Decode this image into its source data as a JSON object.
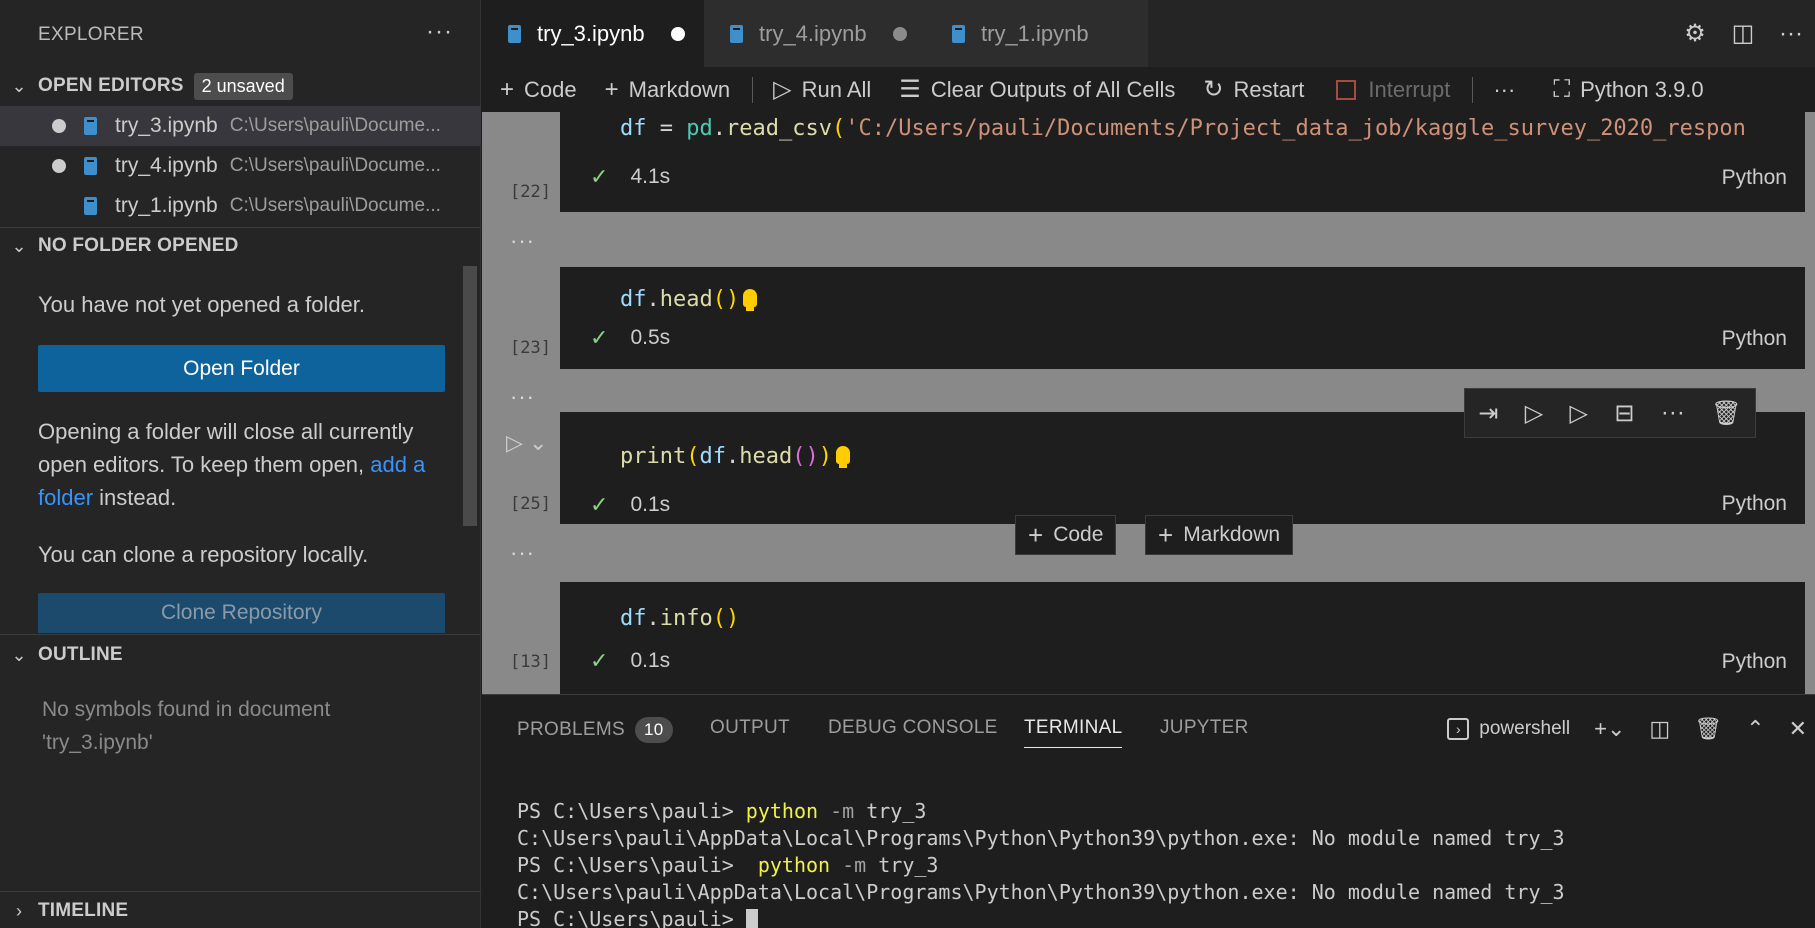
{
  "sidebar": {
    "title": "EXPLORER",
    "more_icon": "ellipsis-icon",
    "open_editors": {
      "label": "OPEN EDITORS",
      "badge": "2 unsaved",
      "items": [
        {
          "name": "try_3.ipynb",
          "path": "C:\\Users\\pauli\\Docume...",
          "dirty": true
        },
        {
          "name": "try_4.ipynb",
          "path": "C:\\Users\\pauli\\Docume...",
          "dirty": true
        },
        {
          "name": "try_1.ipynb",
          "path": "C:\\Users\\pauli\\Docume...",
          "dirty": false
        }
      ]
    },
    "no_folder": {
      "label": "NO FOLDER OPENED",
      "message": "You have not yet opened a folder.",
      "open_button": "Open Folder",
      "info_pre": "Opening a folder will close all currently open editors. To keep them open,",
      "info_link": "add a folder",
      "info_post": " instead.",
      "clone_message": "You can clone a repository locally.",
      "clone_button": "Clone Repository"
    },
    "outline": {
      "label": "OUTLINE",
      "message": "No symbols found in document 'try_3.ipynb'"
    },
    "timeline": {
      "label": "TIMELINE"
    }
  },
  "tabs": [
    {
      "label": "try_3.ipynb",
      "active": true,
      "dirty": true
    },
    {
      "label": "try_4.ipynb",
      "active": false,
      "dirty": true
    },
    {
      "label": "try_1.ipynb",
      "active": false,
      "dirty": false
    }
  ],
  "toolbar": {
    "code": "Code",
    "markdown": "Markdown",
    "run_all": "Run All",
    "clear_outputs": "Clear Outputs of All Cells",
    "restart": "Restart",
    "interrupt": "Interrupt",
    "more": "···",
    "kernel": "Python 3.9.0"
  },
  "cells": [
    {
      "exec_count": "[22]",
      "code_tokens": [
        {
          "t": "df",
          "c": "var"
        },
        {
          "t": " = ",
          "c": "op"
        },
        {
          "t": "pd",
          "c": "mod"
        },
        {
          "t": ".",
          "c": "op"
        },
        {
          "t": "read_csv",
          "c": "fn"
        },
        {
          "t": "(",
          "c": "p1"
        },
        {
          "t": "'C:/Users/pauli/Documents/Project_data_job/kaggle_survey_2020_respon",
          "c": "str"
        }
      ],
      "duration": "4.1s",
      "language": "Python"
    },
    {
      "exec_count": "[23]",
      "code_tokens": [
        {
          "t": "df",
          "c": "var"
        },
        {
          "t": ".",
          "c": "op"
        },
        {
          "t": "head",
          "c": "fn"
        },
        {
          "t": "()",
          "c": "p1"
        }
      ],
      "duration": "0.5s",
      "language": "Python"
    },
    {
      "exec_count": "[25]",
      "code_tokens": [
        {
          "t": "print",
          "c": "fn"
        },
        {
          "t": "(",
          "c": "p1"
        },
        {
          "t": "df",
          "c": "var"
        },
        {
          "t": ".",
          "c": "op"
        },
        {
          "t": "head",
          "c": "fn"
        },
        {
          "t": "()",
          "c": "p2"
        },
        {
          "t": ")",
          "c": "p1"
        }
      ],
      "duration": "0.1s",
      "language": "Python"
    },
    {
      "exec_count": "[13]",
      "code_tokens": [
        {
          "t": "df",
          "c": "var"
        },
        {
          "t": ".",
          "c": "op"
        },
        {
          "t": "info",
          "c": "fn"
        },
        {
          "t": "()",
          "c": "p1"
        }
      ],
      "duration": "0.1s",
      "language": "Python"
    }
  ],
  "insert": {
    "code": "Code",
    "markdown": "Markdown"
  },
  "panel": {
    "tabs": {
      "problems": "PROBLEMS",
      "problems_count": "10",
      "output": "OUTPUT",
      "debug_console": "DEBUG CONSOLE",
      "terminal": "TERMINAL",
      "jupyter": "JUPYTER"
    },
    "shell": "powershell",
    "terminal_lines": [
      {
        "prompt": "PS C:\\Users\\pauli> ",
        "cmd": "python",
        "flag": " -m",
        "arg": " try_3"
      },
      {
        "text": "C:\\Users\\pauli\\AppData\\Local\\Programs\\Python\\Python39\\python.exe: No module named try_3"
      },
      {
        "prompt": "PS C:\\Users\\pauli>  ",
        "cmd": "python",
        "flag": " -m",
        "arg": " try_3"
      },
      {
        "text": "C:\\Users\\pauli\\AppData\\Local\\Programs\\Python\\Python39\\python.exe: No module named try_3"
      },
      {
        "prompt": "PS C:\\Users\\pauli> ",
        "cursor": true
      }
    ]
  },
  "colors": {
    "accent_button": "#0e639c",
    "link": "#3794ff",
    "check": "#89d185",
    "notebook_bg": "#898989"
  }
}
